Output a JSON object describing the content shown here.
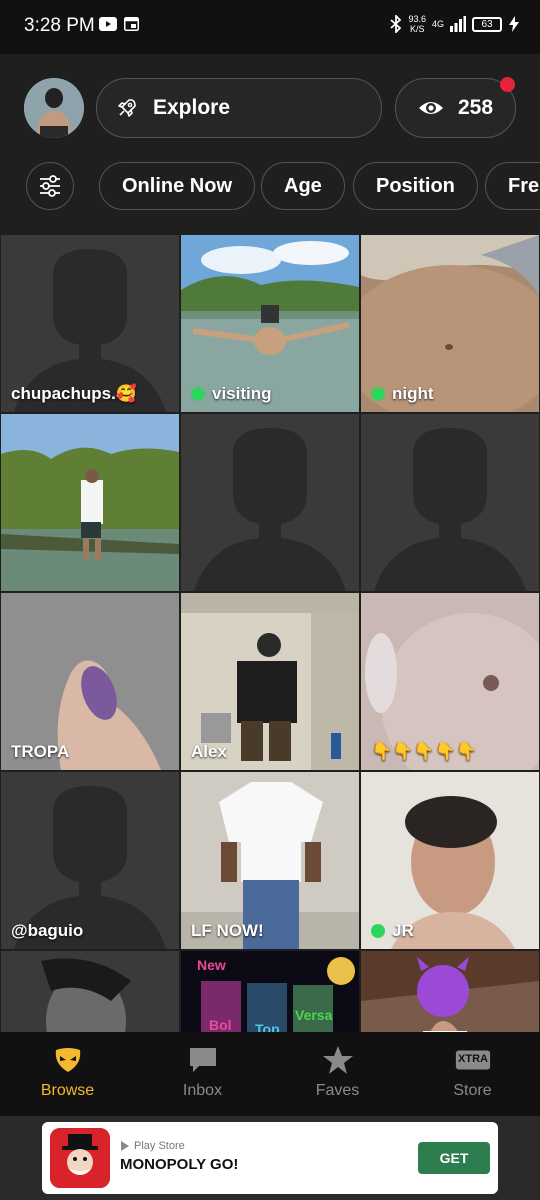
{
  "status_bar": {
    "time": "3:28 PM",
    "net_speed": "93.6",
    "net_unit": "K/S",
    "network": "4G",
    "battery": "63"
  },
  "header": {
    "explore_label": "Explore",
    "views_count": "258"
  },
  "filters": [
    "Online Now",
    "Age",
    "Position",
    "Fre"
  ],
  "grid": {
    "profiles": [
      {
        "name": "chupachups.🥰",
        "online": false,
        "photo": "silhouette"
      },
      {
        "name": "visiting",
        "online": true,
        "photo": "lake"
      },
      {
        "name": "night",
        "online": true,
        "photo": "torso"
      },
      {
        "name": "",
        "online": false,
        "photo": "river"
      },
      {
        "name": "",
        "online": false,
        "photo": "silhouette"
      },
      {
        "name": "",
        "online": false,
        "photo": "silhouette"
      },
      {
        "name": "TROPA",
        "online": false,
        "photo": "finger"
      },
      {
        "name": "Alex",
        "online": false,
        "photo": "restroom"
      },
      {
        "name": "👇👇👇👇👇",
        "online": false,
        "photo": "skin"
      },
      {
        "name": "@baguio",
        "online": false,
        "photo": "silhouette"
      },
      {
        "name": "LF NOW!",
        "online": false,
        "photo": "tshirt"
      },
      {
        "name": "JR",
        "online": true,
        "photo": "blurface"
      },
      {
        "name": "",
        "online": false,
        "photo": "dark"
      },
      {
        "name": "",
        "online": false,
        "photo": "poppers"
      },
      {
        "name": "",
        "online": false,
        "photo": "devil"
      }
    ],
    "poppers_text": {
      "new": "New",
      "versa": "Versa",
      "bol": "Bol",
      "top": "Top"
    }
  },
  "bottom_nav": [
    {
      "label": "Browse",
      "icon": "grindr-mask-icon",
      "active": true
    },
    {
      "label": "Inbox",
      "icon": "chat-bubble-icon",
      "active": false
    },
    {
      "label": "Faves",
      "icon": "star-icon",
      "active": false
    },
    {
      "label": "Store",
      "icon": "xtra-icon",
      "active": false
    }
  ],
  "store_badge": "XTRA",
  "ad": {
    "store": "Play Store",
    "title": "MONOPOLY GO!",
    "cta": "GET"
  },
  "colors": {
    "accent": "#f5b82e",
    "online": "#2fd45a",
    "notification": "#e8223b",
    "background": "#1f1f1f"
  }
}
